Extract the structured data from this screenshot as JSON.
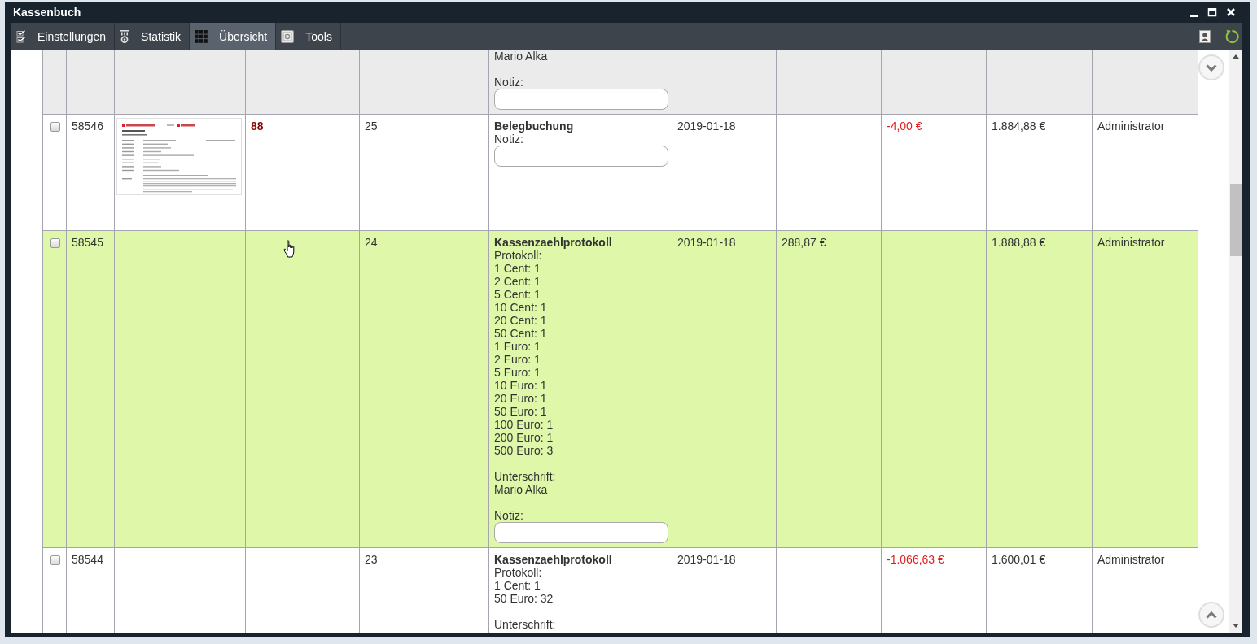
{
  "window": {
    "title": "Kassenbuch"
  },
  "toolbar": {
    "tabs": [
      {
        "label": "Einstellungen",
        "selected": false
      },
      {
        "label": "Statistik",
        "selected": false
      },
      {
        "label": "Übersicht",
        "selected": true
      },
      {
        "label": "Tools",
        "selected": false
      }
    ]
  },
  "table": {
    "rows": [
      {
        "selected": true,
        "hovered": false,
        "thumbnail": false,
        "column_6": {
          "paragraphs": [
            [
              "Mario Alka"
            ]
          ],
          "note": {
            "label": "Notiz:"
          }
        }
      },
      {
        "selected": false,
        "hovered": false,
        "checked": false,
        "column_2": "58546",
        "thumbnail": true,
        "column_4": "88",
        "column_5": "25",
        "column_6": {
          "title": "Belegbuchung",
          "note": {
            "label": "Notiz:"
          }
        },
        "column_7": "2019-01-18",
        "column_9": "-4,00 €",
        "column_10": "1.884,88 €",
        "column_11": "Administrator"
      },
      {
        "selected": false,
        "hovered": true,
        "checked": false,
        "column_2": "58545",
        "thumbnail": false,
        "column_5": "24",
        "column_6": {
          "title": "Kassenzaehlprotokoll",
          "paragraphs": [
            [
              "Protokoll:",
              "1 Cent: 1",
              "2 Cent: 1",
              "5 Cent: 1",
              "10 Cent: 1",
              "20 Cent: 1",
              "50 Cent: 1",
              "1 Euro: 1",
              "2 Euro: 1",
              "5 Euro: 1",
              "10 Euro: 1",
              "20 Euro: 1",
              "50 Euro: 1",
              "100 Euro: 1",
              "200 Euro: 1",
              "500 Euro: 3"
            ],
            [
              "Unterschrift:",
              "Mario Alka"
            ]
          ],
          "note": {
            "label": "Notiz:"
          }
        },
        "column_7": "2019-01-18",
        "column_8": "288,87 €",
        "column_10": "1.888,88 €",
        "column_11": "Administrator"
      },
      {
        "selected": false,
        "hovered": false,
        "checked": false,
        "column_2": "58544",
        "thumbnail": false,
        "column_5": "23",
        "column_6": {
          "title": "Kassenzaehlprotokoll",
          "paragraphs": [
            [
              "Protokoll:",
              "1 Cent: 1",
              "50 Euro: 32"
            ],
            [
              "Unterschrift:"
            ]
          ]
        },
        "column_7": "2019-01-18",
        "column_9": "-1.066,63 €",
        "column_10": "1.600,01 €",
        "column_11": "Administrator"
      }
    ]
  }
}
